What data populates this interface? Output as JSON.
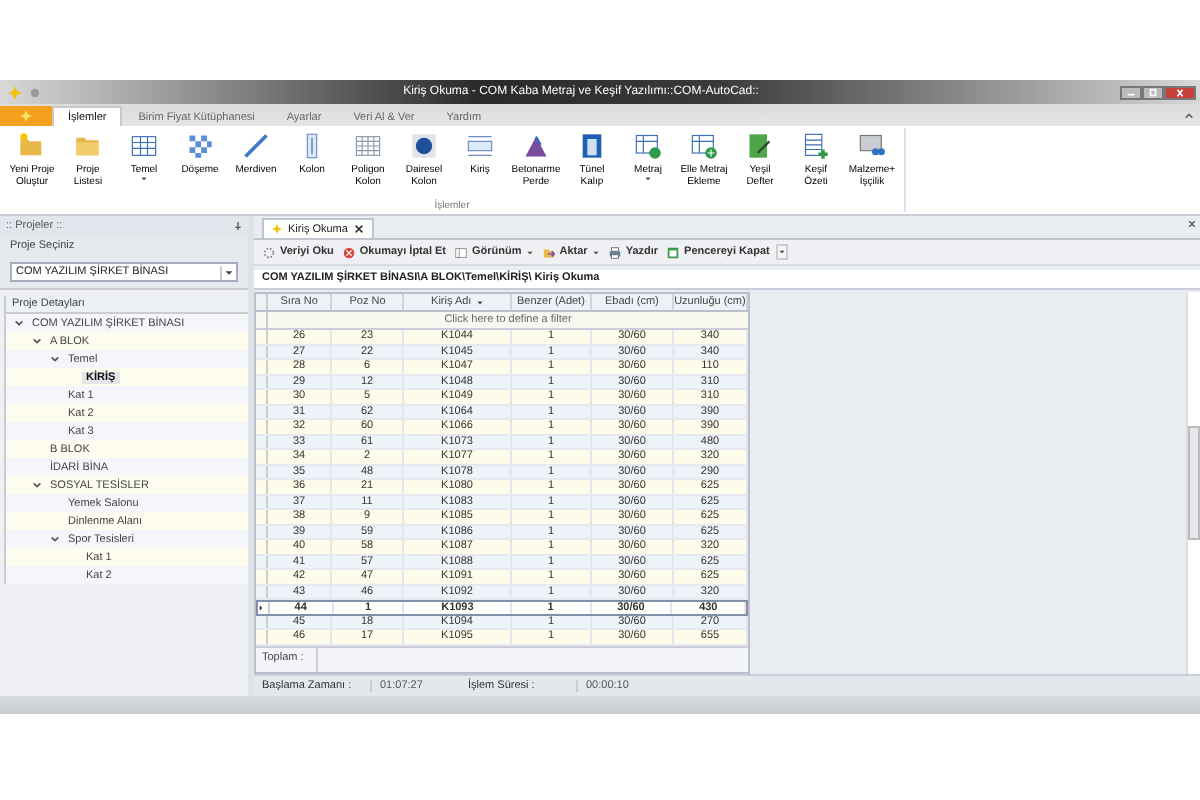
{
  "window": {
    "title": "Kiriş Okuma - COM Kaba Metraj ve Keşif Yazılımı::COM-AutoCad::"
  },
  "ribbon_tabs": [
    {
      "label": "İşlemler",
      "selected": true
    },
    {
      "label": "Birim Fiyat Kütüphanesi",
      "selected": false
    },
    {
      "label": "Ayarlar",
      "selected": false
    },
    {
      "label": "Veri Al & Ver",
      "selected": false
    },
    {
      "label": "Yardım",
      "selected": false
    }
  ],
  "ribbon_buttons": [
    {
      "label": "Yeni Proje\nOluştur",
      "has_menu": false
    },
    {
      "label": "Proje\nListesi",
      "has_menu": false
    },
    {
      "label": "Temel",
      "has_menu": true
    },
    {
      "label": "Döşeme",
      "has_menu": false
    },
    {
      "label": "Merdiven",
      "has_menu": false
    },
    {
      "label": "Kolon",
      "has_menu": false
    },
    {
      "label": "Poligon\nKolon",
      "has_menu": false
    },
    {
      "label": "Dairesel\nKolon",
      "has_menu": false
    },
    {
      "label": "Kiriş",
      "has_menu": false
    },
    {
      "label": "Betonarme\nPerde",
      "has_menu": false
    },
    {
      "label": "Tünel\nKalıp",
      "has_menu": false
    },
    {
      "label": "Metraj",
      "has_menu": true
    },
    {
      "label": "Elle Metraj\nEkleme",
      "has_menu": false
    },
    {
      "label": "Yeşil\nDefter",
      "has_menu": false
    },
    {
      "label": "Keşif\nÖzeti",
      "has_menu": false
    },
    {
      "label": "Malzeme+\nİşçilik",
      "has_menu": false
    }
  ],
  "ribbon_group": "İşlemler",
  "sidebar": {
    "title": ":: Projeler ::",
    "project_label": "Proje Seçiniz",
    "project_value": "COM YAZILIM ŞİRKET BİNASI",
    "details_label": "Proje Detayları",
    "tree": [
      {
        "label": "COM YAZILIM ŞİRKET BİNASI",
        "selected": false,
        "expanded": true,
        "children": [
          {
            "label": "A BLOK",
            "selected": false,
            "expanded": true,
            "children": [
              {
                "label": "Temel",
                "selected": false,
                "expanded": true,
                "children": [
                  {
                    "label": "KİRİŞ",
                    "selected": true
                  }
                ]
              },
              {
                "label": "Kat 1",
                "selected": false
              },
              {
                "label": "Kat 2",
                "selected": false
              },
              {
                "label": "Kat 3",
                "selected": false
              }
            ]
          },
          {
            "label": "B BLOK",
            "selected": false
          },
          {
            "label": "İDARİ BİNA",
            "selected": false
          },
          {
            "label": "SOSYAL TESİSLER",
            "selected": false,
            "expanded": true,
            "children": [
              {
                "label": "Yemek Salonu",
                "selected": false
              },
              {
                "label": "Dinlenme Alanı",
                "selected": false
              },
              {
                "label": "Spor Tesisleri",
                "selected": false,
                "expanded": true,
                "children": [
                  {
                    "label": "Kat 1",
                    "selected": false
                  },
                  {
                    "label": "Kat 2",
                    "selected": false
                  }
                ]
              }
            ]
          }
        ]
      }
    ]
  },
  "document_tab": {
    "label": "Kiriş Okuma"
  },
  "toolbar": [
    {
      "label": "Veriyi Oku",
      "has_menu": false
    },
    {
      "label": "Okumayı İptal Et",
      "has_menu": false
    },
    {
      "label": "Görünüm",
      "has_menu": true
    },
    {
      "label": "Aktar",
      "has_menu": true
    },
    {
      "label": "Yazdır",
      "has_menu": false
    },
    {
      "label": "Pencereyi Kapat",
      "has_menu": false
    }
  ],
  "breadcrumb": "COM YAZILIM ŞİRKET BİNASI\\A BLOK\\Temel\\KİRİŞ\\ Kiriş Okuma",
  "table": {
    "columns": [
      {
        "label": "Sıra No",
        "filtered": false
      },
      {
        "label": "Poz No",
        "filtered": false
      },
      {
        "label": "Kiriş Adı",
        "filtered": true
      },
      {
        "label": "Benzer (Adet)",
        "filtered": false
      },
      {
        "label": "Ebadı (cm)",
        "filtered": false
      },
      {
        "label": "Uzunluğu (cm)",
        "filtered": false
      }
    ],
    "filter_hint": "Click here to define a filter",
    "rows": [
      {
        "cells": [
          "26",
          "23",
          "K1044",
          "1",
          "30/60",
          "340"
        ],
        "selected": false
      },
      {
        "cells": [
          "27",
          "22",
          "K1045",
          "1",
          "30/60",
          "340"
        ],
        "selected": false
      },
      {
        "cells": [
          "28",
          "6",
          "K1047",
          "1",
          "30/60",
          "110"
        ],
        "selected": false
      },
      {
        "cells": [
          "29",
          "12",
          "K1048",
          "1",
          "30/60",
          "310"
        ],
        "selected": false
      },
      {
        "cells": [
          "30",
          "5",
          "K1049",
          "1",
          "30/60",
          "310"
        ],
        "selected": false
      },
      {
        "cells": [
          "31",
          "62",
          "K1064",
          "1",
          "30/60",
          "390"
        ],
        "selected": false
      },
      {
        "cells": [
          "32",
          "60",
          "K1066",
          "1",
          "30/60",
          "390"
        ],
        "selected": false
      },
      {
        "cells": [
          "33",
          "61",
          "K1073",
          "1",
          "30/60",
          "480"
        ],
        "selected": false
      },
      {
        "cells": [
          "34",
          "2",
          "K1077",
          "1",
          "30/60",
          "320"
        ],
        "selected": false
      },
      {
        "cells": [
          "35",
          "48",
          "K1078",
          "1",
          "30/60",
          "290"
        ],
        "selected": false
      },
      {
        "cells": [
          "36",
          "21",
          "K1080",
          "1",
          "30/60",
          "625"
        ],
        "selected": false
      },
      {
        "cells": [
          "37",
          "11",
          "K1083",
          "1",
          "30/60",
          "625"
        ],
        "selected": false
      },
      {
        "cells": [
          "38",
          "9",
          "K1085",
          "1",
          "30/60",
          "625"
        ],
        "selected": false
      },
      {
        "cells": [
          "39",
          "59",
          "K1086",
          "1",
          "30/60",
          "625"
        ],
        "selected": false
      },
      {
        "cells": [
          "40",
          "58",
          "K1087",
          "1",
          "30/60",
          "320"
        ],
        "selected": false
      },
      {
        "cells": [
          "41",
          "57",
          "K1088",
          "1",
          "30/60",
          "625"
        ],
        "selected": false
      },
      {
        "cells": [
          "42",
          "47",
          "K1091",
          "1",
          "30/60",
          "625"
        ],
        "selected": false
      },
      {
        "cells": [
          "43",
          "46",
          "K1092",
          "1",
          "30/60",
          "320"
        ],
        "selected": false
      },
      {
        "cells": [
          "44",
          "1",
          "K1093",
          "1",
          "30/60",
          "430"
        ],
        "selected": true
      },
      {
        "cells": [
          "45",
          "18",
          "K1094",
          "1",
          "30/60",
          "270"
        ],
        "selected": false
      },
      {
        "cells": [
          "46",
          "17",
          "K1095",
          "1",
          "30/60",
          "655"
        ],
        "selected": false
      }
    ],
    "footer_label": "Toplam :"
  },
  "status_bar": {
    "start_label": "Başlama Zamanı :",
    "start_value": "01:07:27",
    "duration_label": "İşlem Süresi :",
    "duration_value": "00:00:10"
  }
}
